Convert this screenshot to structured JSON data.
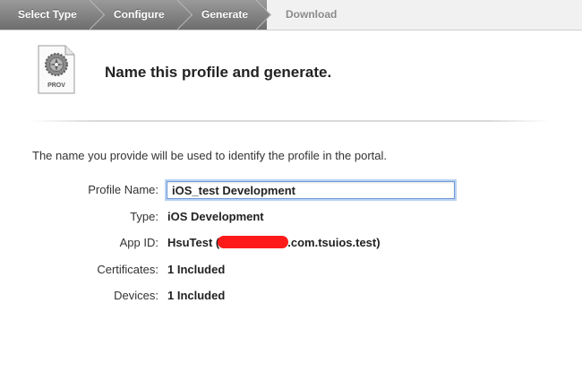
{
  "wizard": {
    "steps": [
      {
        "label": "Select Type",
        "state": "done"
      },
      {
        "label": "Configure",
        "state": "done"
      },
      {
        "label": "Generate",
        "state": "current"
      },
      {
        "label": "Download",
        "state": "pending"
      }
    ]
  },
  "header": {
    "icon_name": "provisioning-profile-icon",
    "icon_label": "PROV",
    "title": "Name this profile and generate."
  },
  "description": "The name you provide will be used to identify the profile in the portal.",
  "form": {
    "profile_name": {
      "label": "Profile Name:",
      "value": "iOS_test Development"
    },
    "type": {
      "label": "Type:",
      "value": "iOS Development"
    },
    "app_id": {
      "label": "App ID:",
      "value_prefix": "HsuTest (",
      "value_suffix": ".com.tsuios.test)"
    },
    "certificates": {
      "label": "Certificates:",
      "value": "1 Included"
    },
    "devices": {
      "label": "Devices:",
      "value": "1 Included"
    }
  },
  "colors": {
    "step_active": "#7f7f7f",
    "step_pending_text": "#8a8a8a",
    "input_focus": "#6f9ad6",
    "redaction": "#ff1a1a"
  }
}
